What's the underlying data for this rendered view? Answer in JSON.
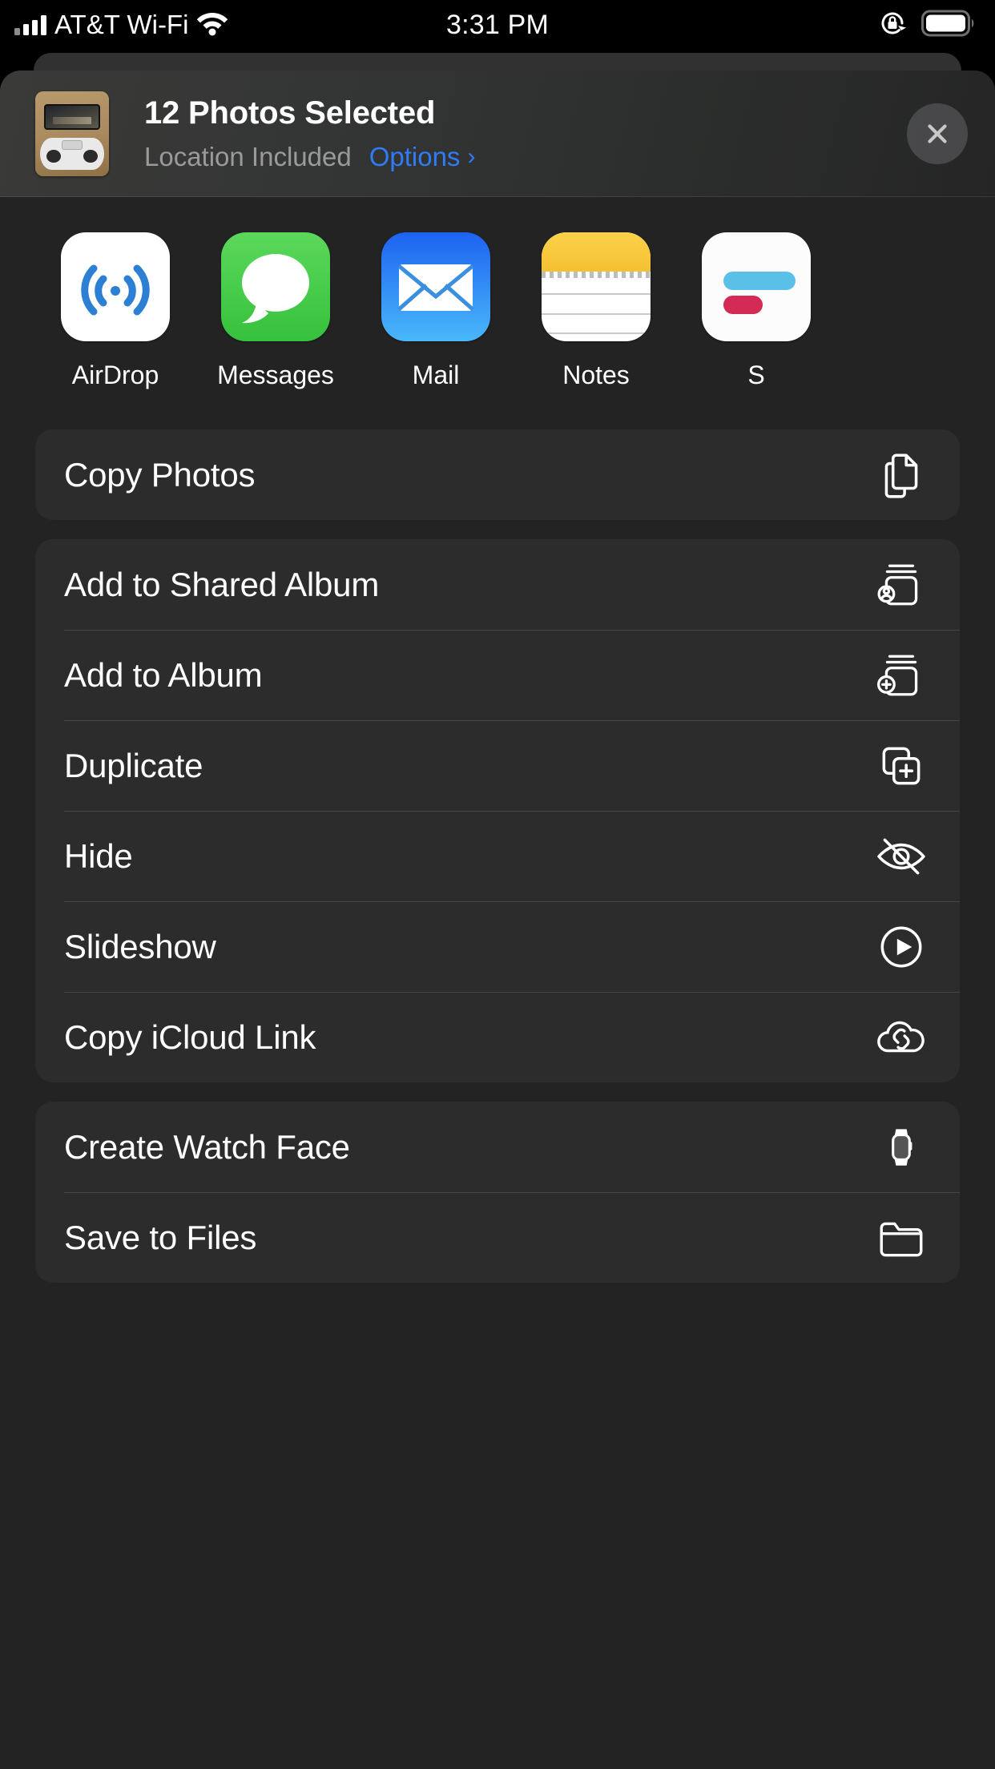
{
  "status_bar": {
    "carrier": "AT&T Wi-Fi",
    "wifi_icon": "wifi-icon",
    "signal_icon": "cellular-signal-icon",
    "time": "3:31 PM",
    "rotation_lock_icon": "rotation-lock-icon",
    "battery_icon": "battery-full-icon"
  },
  "header": {
    "title": "12 Photos Selected",
    "subtitle": "Location Included",
    "options_label": "Options",
    "options_chevron": "›",
    "close_icon": "close-icon",
    "thumbnail_name": "selection-thumbnail"
  },
  "apps": [
    {
      "label": "AirDrop",
      "icon": "airdrop-icon"
    },
    {
      "label": "Messages",
      "icon": "messages-icon"
    },
    {
      "label": "Mail",
      "icon": "mail-icon"
    },
    {
      "label": "Notes",
      "icon": "notes-icon"
    },
    {
      "label": "S",
      "icon": "shortcuts-icon"
    }
  ],
  "action_groups": [
    {
      "rows": [
        {
          "label": "Copy Photos",
          "icon": "doc-on-doc-icon"
        }
      ]
    },
    {
      "rows": [
        {
          "label": "Add to Shared Album",
          "icon": "shared-album-icon"
        },
        {
          "label": "Add to Album",
          "icon": "add-album-icon"
        },
        {
          "label": "Duplicate",
          "icon": "duplicate-icon"
        },
        {
          "label": "Hide",
          "icon": "eye-slash-icon"
        },
        {
          "label": "Slideshow",
          "icon": "play-circle-icon"
        },
        {
          "label": "Copy iCloud Link",
          "icon": "cloud-link-icon"
        }
      ]
    },
    {
      "rows": [
        {
          "label": "Create Watch Face",
          "icon": "apple-watch-icon"
        },
        {
          "label": "Save to Files",
          "icon": "folder-icon"
        }
      ]
    }
  ],
  "colors": {
    "accent_blue": "#2f7cf6",
    "sheet_background": "#232323",
    "row_background": "#2c2c2c",
    "subtitle_gray": "#9a9a9a",
    "messages_green": "#36c13c",
    "mail_blue": "#1d62f0",
    "notes_yellow": "#f5c032"
  }
}
